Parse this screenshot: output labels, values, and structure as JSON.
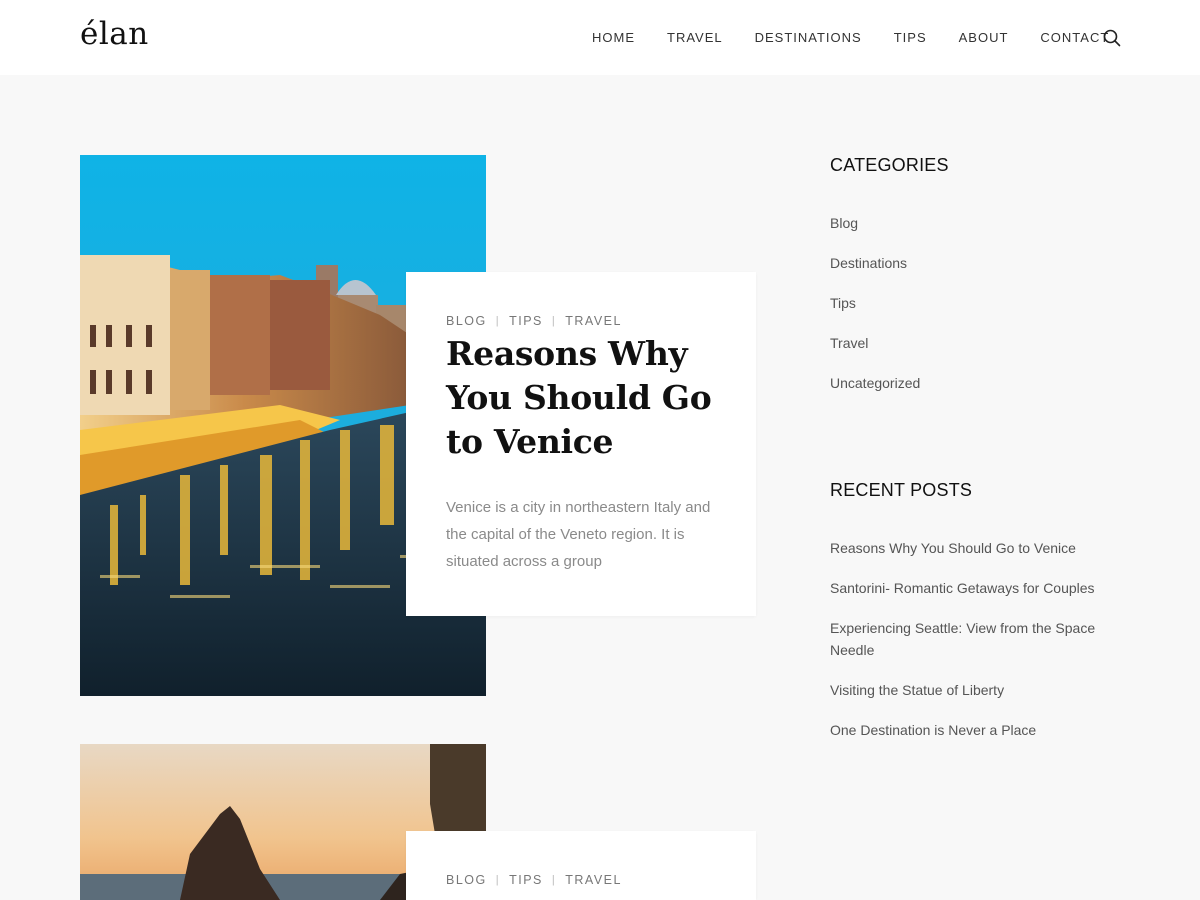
{
  "site": {
    "logo": "élan"
  },
  "nav": {
    "items": [
      "HOME",
      "TRAVEL",
      "DESTINATIONS",
      "TIPS",
      "ABOUT",
      "CONTACT"
    ],
    "search_icon": "search-icon"
  },
  "posts": [
    {
      "categories": [
        "BLOG",
        "TIPS",
        "TRAVEL"
      ],
      "title": "Reasons Why You Should Go to Venice",
      "excerpt": "Venice is a city in northeastern Italy and the capital of the Veneto region. It is situated across a group",
      "image": "venice-canal-night"
    },
    {
      "categories": [
        "BLOG",
        "TIPS",
        "TRAVEL"
      ],
      "title": "",
      "image": "rocky-coast-sunset"
    }
  ],
  "sidebar": {
    "categories": {
      "heading": "CATEGORIES",
      "items": [
        "Blog",
        "Destinations",
        "Tips",
        "Travel",
        "Uncategorized"
      ]
    },
    "recent_posts": {
      "heading": "RECENT POSTS",
      "items": [
        "Reasons Why You Should Go to Venice",
        "Santorini- Romantic Getaways for Couples",
        "Experiencing Seattle: View from the Space Needle",
        "Visiting the Statue of Liberty",
        "One Destination is Never a Place"
      ]
    }
  }
}
